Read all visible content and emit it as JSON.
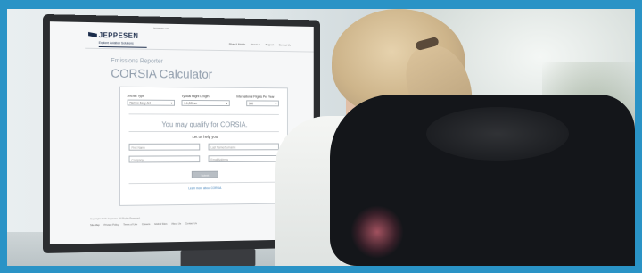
{
  "browser": {
    "url": "jeppesen.com"
  },
  "brand": {
    "logo": "JEPPESEN",
    "tagline": "Explore Aviation Solutions"
  },
  "nav": [
    {
      "label": "Pilots & Mobile"
    },
    {
      "label": "About Us"
    },
    {
      "label": "Support"
    },
    {
      "label": "Contact Us"
    }
  ],
  "calculator": {
    "kicker": "Emissions Reporter",
    "title": "CORSIA Calculator",
    "fields": {
      "aircraft_type": {
        "label": "Aircraft Type",
        "value": "Narrow-body Jet"
      },
      "flight_length": {
        "label": "Typical Flight Length",
        "value": "0-1,000nm"
      },
      "intl_flights": {
        "label": "International Flights Per Year",
        "value": "500"
      }
    },
    "result": "You may qualify for CORSIA.",
    "help_heading": "Let us help you",
    "inputs": {
      "first_name": "First Name",
      "last_name": "Last Name/Surname",
      "company": "Company",
      "email": "Email Address"
    },
    "submit_label": "Submit",
    "learn_more": "Learn more about CORSIA"
  },
  "footer": {
    "copyright": "Copyright 2019 Jeppesen. All Rights Reserved.",
    "links": [
      {
        "label": "Site Map"
      },
      {
        "label": "Privacy Policy"
      },
      {
        "label": "Terms of Use"
      },
      {
        "label": "Careers"
      },
      {
        "label": "Global Sites"
      },
      {
        "label": "About Us"
      },
      {
        "label": "Contact Us"
      }
    ]
  },
  "colors": {
    "frame": "#2a93c6",
    "title": "#8f9cab",
    "chair": "#14161a"
  }
}
